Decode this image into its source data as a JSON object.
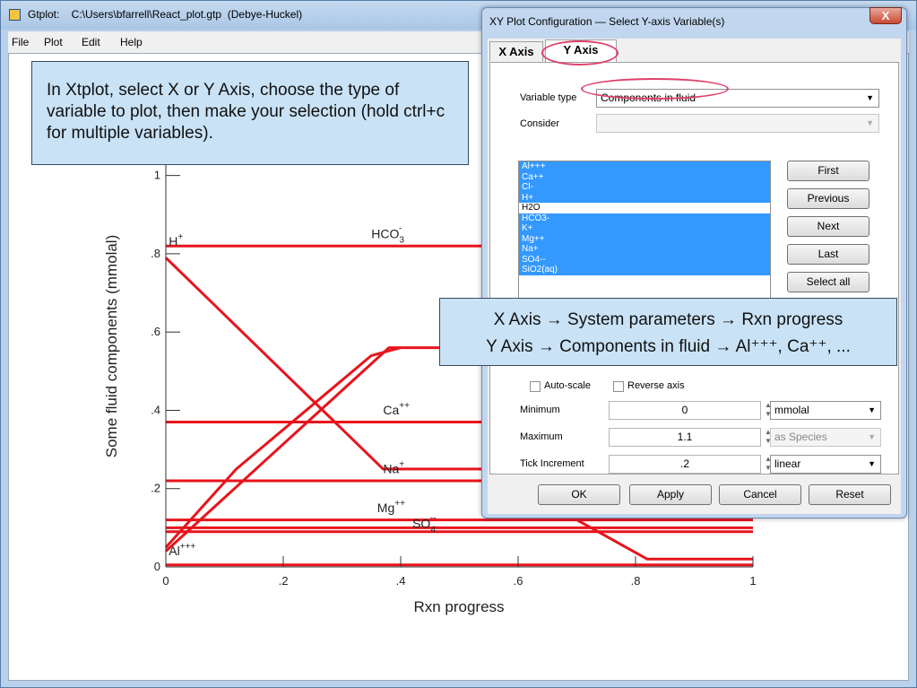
{
  "main_window": {
    "title": "Gtplot:    C:\\Users\\bfarrell\\React_plot.gtp  (Debye-Huckel)",
    "menu": [
      "File",
      "Plot",
      "Edit",
      "Help"
    ]
  },
  "callout_instructions": "In Xtplot, select X or Y Axis, choose the type of variable to plot, then make your selection (hold ctrl+c for multiple variables).",
  "callout_summary": {
    "line1": "X Axis → System parameters → Rxn progress",
    "line2": "Y Axis → Components in fluid → Al⁺⁺⁺, Ca⁺⁺, ..."
  },
  "dialog": {
    "title": "XY Plot Configuration — Select Y-axis Variable(s)",
    "close_glyph": "X",
    "tabs": [
      "X Axis",
      "Y Axis"
    ],
    "variable_type_label": "Variable type",
    "variable_type_value": "Components in fluid",
    "consider_label": "Consider",
    "consider_value": "",
    "variables": [
      {
        "name": "Al+++",
        "selected": true
      },
      {
        "name": "Ca++",
        "selected": true
      },
      {
        "name": "Cl-",
        "selected": true
      },
      {
        "name": "H+",
        "selected": true
      },
      {
        "name": "H2O",
        "selected": false
      },
      {
        "name": "HCO3-",
        "selected": true
      },
      {
        "name": "K+",
        "selected": true
      },
      {
        "name": "Mg++",
        "selected": true
      },
      {
        "name": "Na+",
        "selected": true
      },
      {
        "name": "SO4--",
        "selected": true
      },
      {
        "name": "SiO2(aq)",
        "selected": true
      }
    ],
    "nav_buttons": [
      "First",
      "Previous",
      "Next",
      "Last",
      "Select all"
    ],
    "auto_scale_label": "Auto-scale",
    "reverse_axis_label": "Reverse axis",
    "minimum_label": "Minimum",
    "minimum_value": "0",
    "minimum_unit": "mmolal",
    "maximum_label": "Maximum",
    "maximum_value": "1.1",
    "maximum_unit": "as Species",
    "tick_label": "Tick Increment",
    "tick_value": ".2",
    "tick_scale": "linear",
    "footer_buttons": [
      "OK",
      "Apply",
      "Cancel",
      "Reset"
    ]
  },
  "chart_data": {
    "type": "line",
    "xlabel": "Rxn progress",
    "ylabel": "Some fluid components (mmolal)",
    "xlim": [
      0,
      1
    ],
    "ylim": [
      0,
      1.1
    ],
    "x_ticks": [
      "0",
      ".2",
      ".4",
      ".6",
      ".8",
      "1"
    ],
    "y_ticks": [
      "0",
      ".2",
      ".4",
      ".6",
      ".8",
      "1"
    ],
    "series_color": "#e8141c",
    "series": [
      {
        "name": "H+",
        "points": [
          [
            0,
            0.79
          ],
          [
            0.37,
            0.25
          ],
          [
            1,
            0.25
          ]
        ]
      },
      {
        "name": "HCO3-",
        "points": [
          [
            0,
            0.82
          ],
          [
            1,
            0.82
          ]
        ]
      },
      {
        "name": "Ca++",
        "points": [
          [
            0,
            0.37
          ],
          [
            1,
            0.37
          ]
        ]
      },
      {
        "name": "Na+",
        "points": [
          [
            0,
            0.22
          ],
          [
            1,
            0.22
          ]
        ]
      },
      {
        "name": "Mg++",
        "points": [
          [
            0,
            0.12
          ],
          [
            1,
            0.12
          ]
        ]
      },
      {
        "name": "SO4--",
        "points": [
          [
            0,
            0.09
          ],
          [
            1,
            0.09
          ]
        ]
      },
      {
        "name": "K+",
        "points": [
          [
            0,
            0.1
          ],
          [
            1,
            0.1
          ]
        ]
      },
      {
        "name": "Al+++",
        "points": [
          [
            0,
            0.005
          ],
          [
            1,
            0.005
          ]
        ]
      },
      {
        "name": "SiO2(aq)",
        "points": [
          [
            0,
            0.04
          ],
          [
            0.38,
            0.56
          ],
          [
            1,
            0.56
          ]
        ]
      },
      {
        "name": "",
        "points": [
          [
            0,
            0.05
          ],
          [
            0.12,
            0.25
          ],
          [
            0.35,
            0.54
          ],
          [
            0.4,
            0.56
          ]
        ]
      },
      {
        "name": "",
        "points": [
          [
            0.7,
            0.12
          ],
          [
            0.82,
            0.02
          ],
          [
            1,
            0.02
          ]
        ]
      }
    ],
    "annotations": [
      {
        "text": "H",
        "sup": "+",
        "x": 0.005,
        "y": 0.82
      },
      {
        "text": "HCO",
        "sub": "3",
        "sup": "-",
        "x": 0.35,
        "y": 0.84
      },
      {
        "text": "Ca",
        "sup": "++",
        "x": 0.37,
        "y": 0.39
      },
      {
        "text": "Na",
        "sup": "+",
        "x": 0.37,
        "y": 0.24
      },
      {
        "text": "Mg",
        "sup": "++",
        "x": 0.36,
        "y": 0.14
      },
      {
        "text": "SO",
        "sub": "4",
        "sup": "--",
        "x": 0.42,
        "y": 0.1
      },
      {
        "text": "Al",
        "sup": "+++",
        "x": 0.005,
        "y": 0.03
      }
    ]
  }
}
